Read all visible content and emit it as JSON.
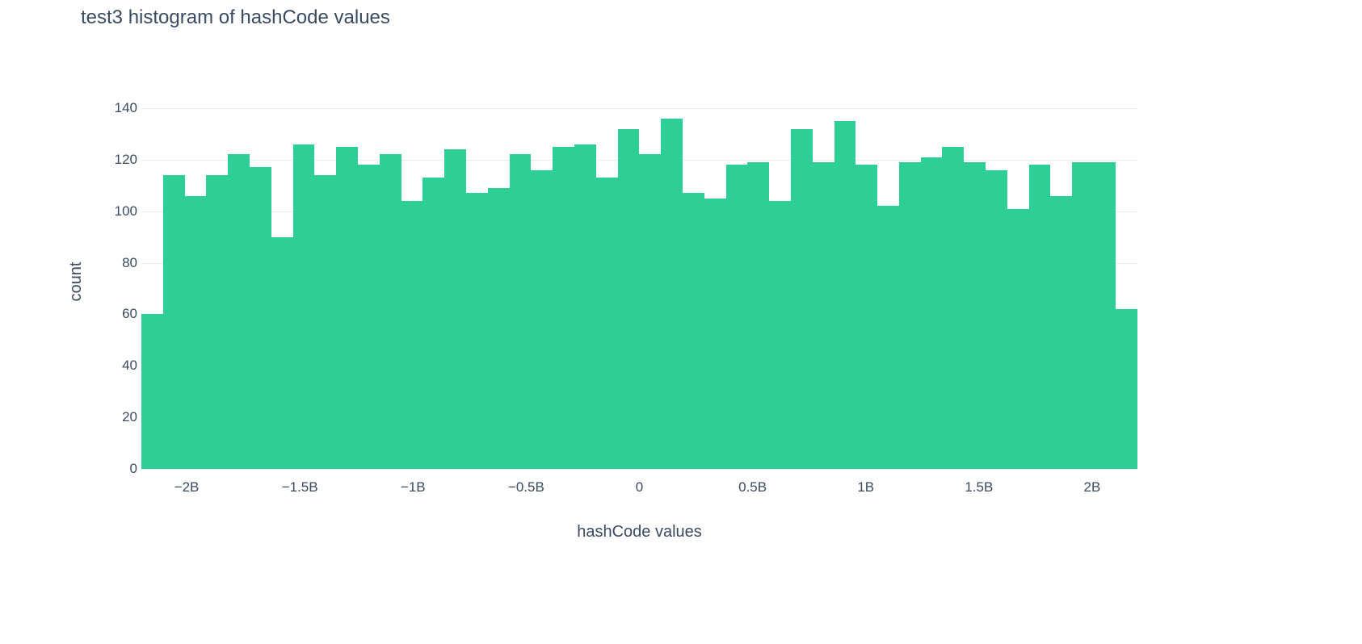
{
  "chart_data": {
    "type": "bar",
    "title": "test3 histogram of hashCode values",
    "xlabel": "hashCode values",
    "ylabel": "count",
    "ylim": [
      0,
      145
    ],
    "y_ticks": [
      0,
      20,
      40,
      60,
      80,
      100,
      120,
      140
    ],
    "x_tick_labels": [
      "−2B",
      "−1.5B",
      "−1B",
      "−0.5B",
      "0",
      "0.5B",
      "1B",
      "1.5B",
      "2B"
    ],
    "x_tick_values": [
      -2000000000.0,
      -1500000000.0,
      -1000000000.0,
      -500000000.0,
      0,
      500000000.0,
      1000000000.0,
      1500000000.0,
      2000000000.0
    ],
    "x_range": [
      -2200000000.0,
      2200000000.0
    ],
    "bar_color": "#2ecf96",
    "values": [
      60,
      114,
      106,
      114,
      122,
      117,
      90,
      126,
      114,
      125,
      118,
      122,
      104,
      113,
      124,
      107,
      109,
      122,
      116,
      125,
      126,
      113,
      132,
      122,
      136,
      107,
      105,
      118,
      119,
      104,
      132,
      119,
      135,
      118,
      102,
      119,
      121,
      125,
      119,
      116,
      101,
      118,
      106,
      119,
      119,
      62
    ]
  }
}
